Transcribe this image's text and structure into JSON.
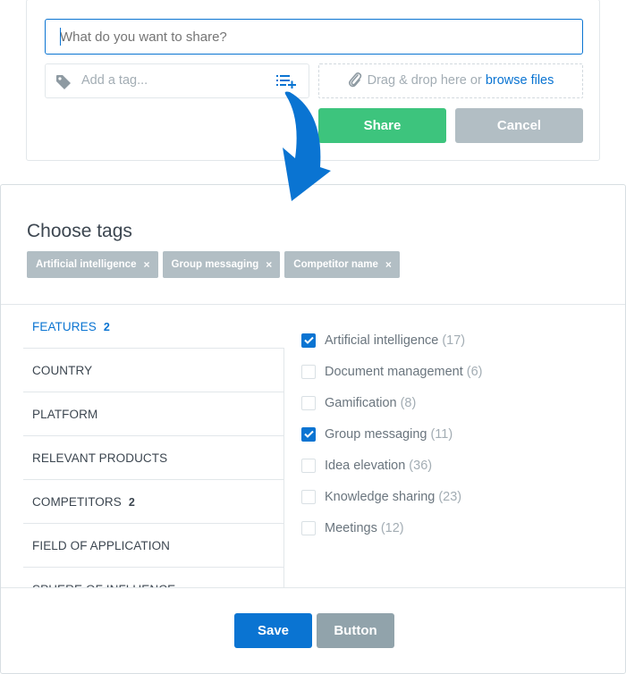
{
  "composer": {
    "share_placeholder": "What do you want to share?",
    "tag_placeholder": "Add a tag...",
    "dropzone_text": "Drag & drop here or ",
    "dropzone_link": "browse files",
    "share_label": "Share",
    "cancel_label": "Cancel"
  },
  "modal": {
    "title": "Choose tags",
    "selected_tags": [
      {
        "label": "Artificial intelligence",
        "remove": "×"
      },
      {
        "label": "Group messaging",
        "remove": "×"
      },
      {
        "label": "Competitor name",
        "remove": "×"
      }
    ],
    "categories": [
      {
        "label": "FEATURES",
        "count": "2",
        "active": true
      },
      {
        "label": "COUNTRY",
        "count": ""
      },
      {
        "label": "PLATFORM",
        "count": ""
      },
      {
        "label": "RELEVANT PRODUCTS",
        "count": ""
      },
      {
        "label": "COMPETITORS",
        "count": "2"
      },
      {
        "label": "FIELD OF APPLICATION",
        "count": ""
      },
      {
        "label": "SPHERE OF INFLUENCE",
        "count": ""
      }
    ],
    "options": [
      {
        "label": "Artificial intelligence",
        "count": "(17)",
        "checked": true
      },
      {
        "label": "Document management",
        "count": "(6)",
        "checked": false
      },
      {
        "label": "Gamification",
        "count": "(8)",
        "checked": false
      },
      {
        "label": "Group messaging",
        "count": "(11)",
        "checked": true
      },
      {
        "label": "Idea elevation",
        "count": "(36)",
        "checked": false
      },
      {
        "label": "Knowledge sharing",
        "count": "(23)",
        "checked": false
      },
      {
        "label": "Meetings",
        "count": "(12)",
        "checked": false
      }
    ],
    "save_label": "Save",
    "secondary_label": "Button"
  },
  "colors": {
    "accent": "#0a74d2",
    "share": "#3dc47d",
    "muted_button": "#b2bec4",
    "chip": "#b2bec4"
  }
}
